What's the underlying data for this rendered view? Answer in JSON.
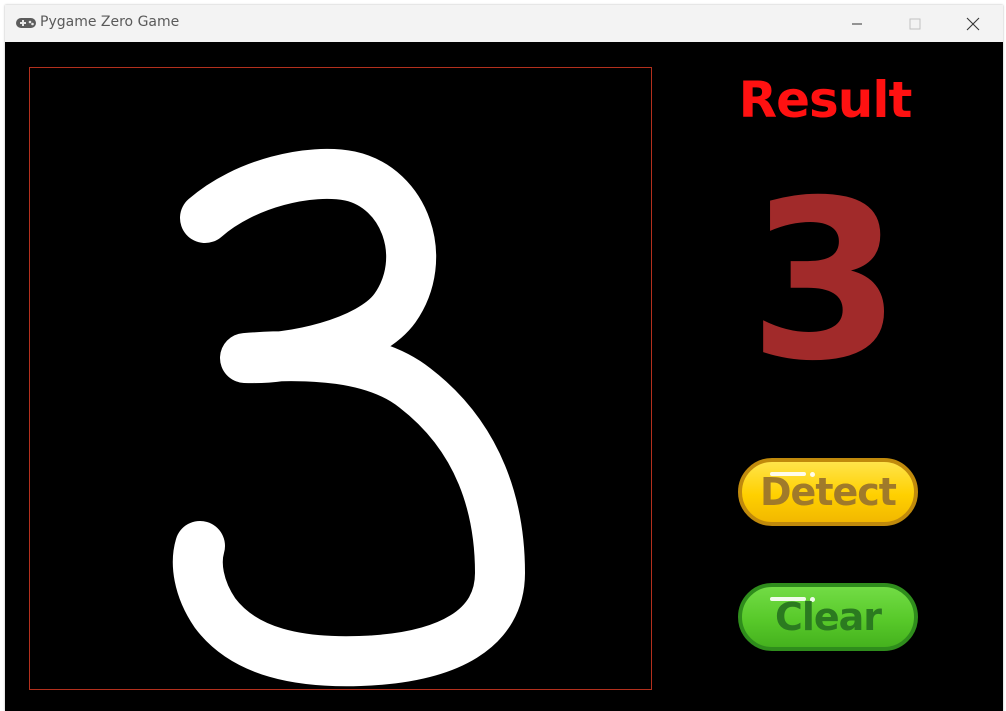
{
  "window": {
    "title": "Pygame Zero Game",
    "app_icon": "gamepad-icon",
    "controls": [
      "minimize-icon",
      "maximize-icon",
      "close-icon"
    ]
  },
  "result": {
    "label": "Result",
    "value": "3"
  },
  "buttons": {
    "detect": "Detect",
    "clear": "Clear"
  },
  "colors": {
    "frame_border": "#b3301d",
    "result_label": "#ff1111",
    "result_digit": "#a12a2a",
    "detect_button": "#ffd000",
    "clear_button": "#58c92a",
    "stroke": "#ffffff",
    "background": "#000000"
  }
}
